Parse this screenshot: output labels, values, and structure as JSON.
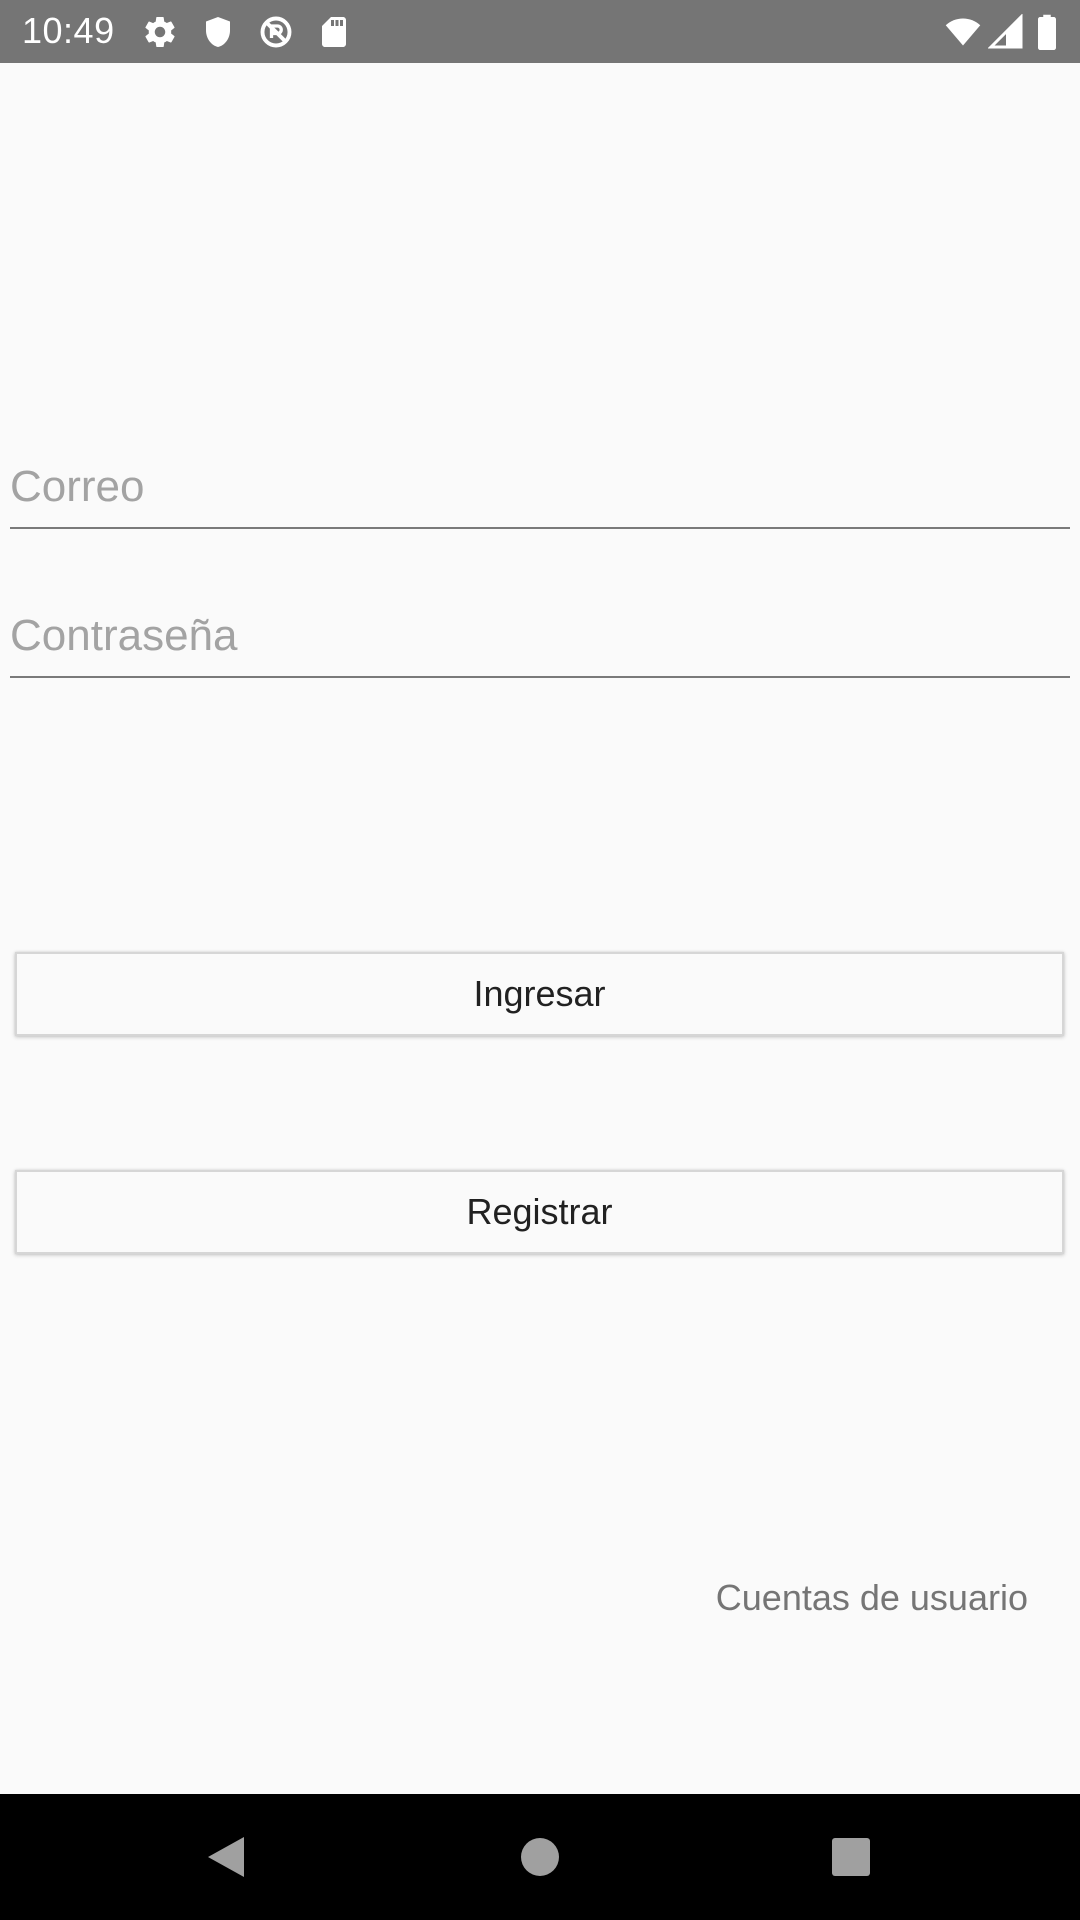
{
  "status_bar": {
    "time": "10:49",
    "left_icons": [
      "gear-icon",
      "shield-icon",
      "no-sync-icon",
      "sd-card-icon"
    ],
    "right_icons": [
      "wifi-icon",
      "cell-signal-icon",
      "battery-icon"
    ],
    "background": "#757575"
  },
  "login_form": {
    "email": {
      "placeholder": "Correo",
      "value": ""
    },
    "password": {
      "placeholder": "Contraseña",
      "value": ""
    },
    "login_button_label": "Ingresar",
    "register_button_label": "Registrar",
    "user_accounts_label": "Cuentas de usuario"
  },
  "nav_bar": {
    "buttons": [
      "back-icon",
      "home-icon",
      "recents-icon"
    ]
  },
  "colors": {
    "background": "#fafafa",
    "text_primary": "#212121",
    "placeholder": "#a3a3a3",
    "secondary_text": "#757575"
  }
}
